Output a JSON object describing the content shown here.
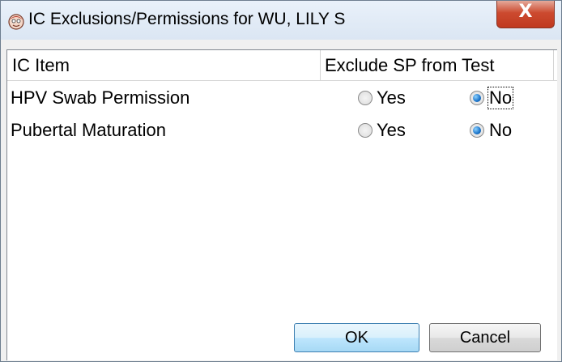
{
  "window": {
    "title": "IC Exclusions/Permissions for WU, LILY S",
    "close_label": "X"
  },
  "list": {
    "columns": [
      "IC Item",
      "Exclude SP from Test"
    ],
    "rows": [
      {
        "label": "HPV Swab Permission",
        "yes_label": "Yes",
        "no_label": "No",
        "selected": "No"
      },
      {
        "label": "Pubertal Maturation",
        "yes_label": "Yes",
        "no_label": "No",
        "selected": "No"
      }
    ]
  },
  "buttons": {
    "ok_label": "OK",
    "cancel_label": "Cancel"
  }
}
